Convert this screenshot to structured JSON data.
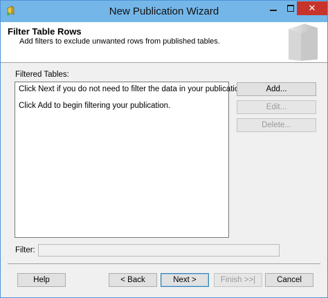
{
  "window": {
    "title": "New Publication Wizard",
    "close_glyph": "✕"
  },
  "header": {
    "title": "Filter Table Rows",
    "subtitle": "Add filters to exclude unwanted rows from published tables."
  },
  "filtered_tables": {
    "label": "Filtered Tables:",
    "lines": [
      "Click Next if you do not need to filter the data in your publication.",
      "Click Add to begin filtering your publication."
    ]
  },
  "side_buttons": {
    "add": "Add...",
    "edit": "Edit...",
    "delete": "Delete..."
  },
  "filter": {
    "label": "Filter:",
    "value": ""
  },
  "footer_buttons": {
    "help": "Help",
    "back": "< Back",
    "next": "Next >",
    "finish": "Finish >>|",
    "cancel": "Cancel"
  }
}
